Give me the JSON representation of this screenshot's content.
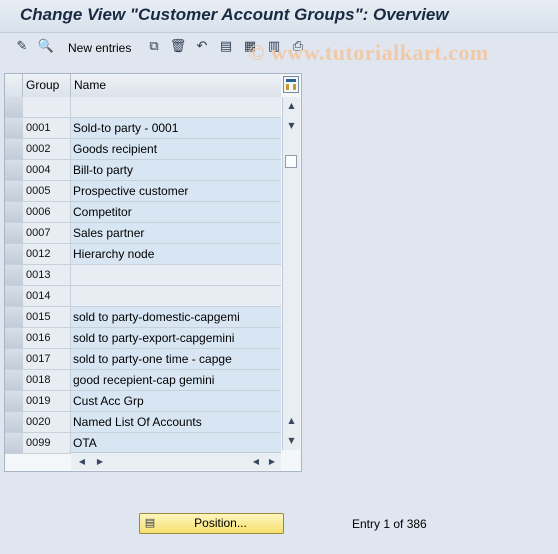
{
  "window": {
    "title": "Change View \"Customer Account Groups\": Overview"
  },
  "toolbar": {
    "new_entries_label": "New entries",
    "icons": [
      "display-change-icon",
      "find-icon",
      "copy-icon",
      "delete-icon",
      "undo-icon",
      "select-all-icon",
      "select-block-icon",
      "deselect-all-icon",
      "print-icon"
    ]
  },
  "watermark": "© www.tutorialkart.com",
  "table": {
    "columns": [
      "Group",
      "Name"
    ],
    "rows": [
      {
        "group": "",
        "name": ""
      },
      {
        "group": "0001",
        "name": "Sold-to party - 0001"
      },
      {
        "group": "0002",
        "name": "Goods recipient"
      },
      {
        "group": "0004",
        "name": "Bill-to party"
      },
      {
        "group": "0005",
        "name": "Prospective customer"
      },
      {
        "group": "0006",
        "name": "Competitor"
      },
      {
        "group": "0007",
        "name": "Sales partner"
      },
      {
        "group": "0012",
        "name": "Hierarchy node"
      },
      {
        "group": "0013",
        "name": ""
      },
      {
        "group": "0014",
        "name": ""
      },
      {
        "group": "0015",
        "name": "sold to party-domestic-capgemi"
      },
      {
        "group": "0016",
        "name": "sold to party-export-capgemini"
      },
      {
        "group": "0017",
        "name": "sold to party-one time - capge"
      },
      {
        "group": "0018",
        "name": "good recepient-cap gemini"
      },
      {
        "group": "0019",
        "name": "Cust Acc Grp"
      },
      {
        "group": "0020",
        "name": "Named List Of Accounts"
      },
      {
        "group": "0099",
        "name": "OTA"
      }
    ]
  },
  "footer": {
    "position_button_label": "Position...",
    "entry_info": "Entry 1 of 386"
  }
}
